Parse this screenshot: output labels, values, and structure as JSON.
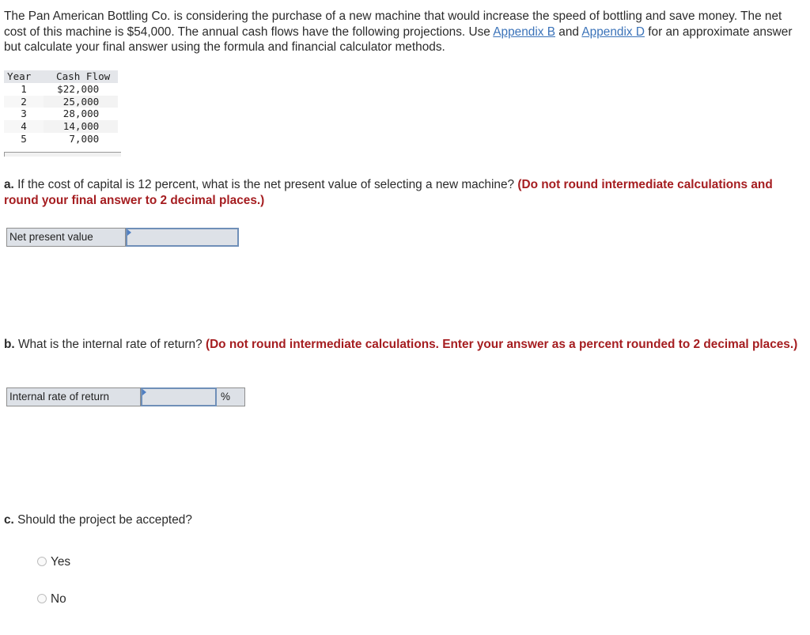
{
  "intro": {
    "text_1": "The Pan American Bottling Co. is considering the purchase of a new machine that would increase the speed of bottling and save money. The net cost of this machine is $54,000. The annual cash flows have the following projections. Use ",
    "link_1": "Appendix B",
    "text_2": " and ",
    "link_2": "Appendix D",
    "text_3": " for an approximate answer but calculate your final answer using the formula and financial calculator methods."
  },
  "cash_flow_table": {
    "headers": [
      "Year",
      "Cash Flow"
    ],
    "rows": [
      {
        "year": "1",
        "cash_flow": "$22,000"
      },
      {
        "year": "2",
        "cash_flow": "25,000"
      },
      {
        "year": "3",
        "cash_flow": "28,000"
      },
      {
        "year": "4",
        "cash_flow": "14,000"
      },
      {
        "year": "5",
        "cash_flow": "7,000"
      }
    ]
  },
  "question_a": {
    "letter": "a.",
    "text": " If the cost of capital is 12 percent, what is the net present value of selecting a new machine? ",
    "instruction": "(Do not round intermediate calculations and round your final answer to 2 decimal places.)",
    "field_label": "Net present value",
    "field_value": ""
  },
  "question_b": {
    "letter": "b.",
    "text": " What is the internal rate of return? ",
    "instruction": "(Do not round intermediate calculations. Enter your answer as a percent rounded to 2 decimal places.)",
    "field_label": "Internal rate of return",
    "field_value": "",
    "unit": "%"
  },
  "question_c": {
    "letter": "c.",
    "text": " Should the project be accepted?",
    "options": [
      "Yes",
      "No"
    ],
    "selected": null
  }
}
